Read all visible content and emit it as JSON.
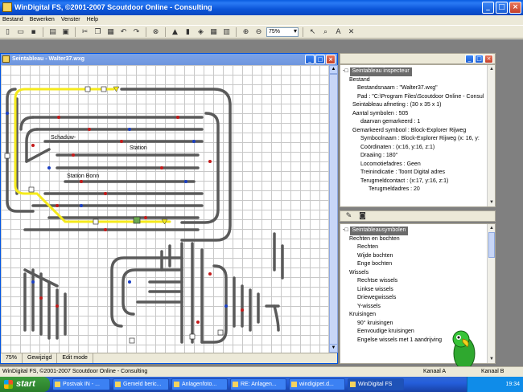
{
  "window": {
    "title": "WinDigital FS, ©2001-2007 Scoutdoor Online - Consulting",
    "buttons": {
      "minimize": "_",
      "maximize": "□",
      "close": "×"
    }
  },
  "menu": [
    "Bestand",
    "Bewerken",
    "Venster",
    "Help"
  ],
  "toolbar": {
    "zoom": "75%"
  },
  "child": {
    "title": "Seintableau - Walter37.wxg",
    "canvas_labels": {
      "schaduw": "Schaduw-",
      "station": "Station",
      "station_bonn": "Station Bonn"
    },
    "status": {
      "zoom": "75%",
      "state": "Gewijzigd",
      "mode": "Edit mode"
    }
  },
  "inspector": {
    "root": "Seintableau inspecteur",
    "items": [
      "Bestand",
      "Bestandsnaam : \"Walter37.wxg\"",
      "Pad : \"C:\\Program Files\\Scoutdoor Online - Consul",
      "Seintableau afmeting : (30 x 35 x 1)",
      "Aantal symbolen : 505",
      "daarvan gemarkeerd : 1",
      "Gemarkeerd symbool : Block-Explorer Rijweg",
      "Symboolnaam : Block-Explorer Rijweg (x: 16, y:",
      "Coördinaten : (x:16, y:16, z:1)",
      "Draaiing : 180°",
      "Locomotiefadres : Geen",
      "Treinindicatie : Toont Digital adres",
      "Terugmeldcontact : (x:17, y:16, z:1)",
      "Terugmeldadres : 20"
    ]
  },
  "symbols": {
    "root": "Seintableausymbolen",
    "items": [
      "Rechten en bochten",
      "Rechten",
      "Wijde bochten",
      "Enge bochten",
      "Wissels",
      "Rechtse wissels",
      "Linkse wissels",
      "Driewegwissels",
      "Y-wissels",
      "Kruisingen",
      "90° kruisingen",
      "Eenvoudige kruisingen",
      "Engelse wissels met 1 aandrijving"
    ]
  },
  "statusbar": {
    "text": "WinDigital FS, ©2001-2007 Scoutdoor Online - Consulting",
    "kanaal_a": "Kanaal A",
    "kanaal_b": "Kanaal B"
  },
  "taskbar": {
    "start": "start",
    "tasks": [
      "Postvak IN - ...",
      "Gemeld beric...",
      "Anlagenfoto...",
      "RE: Anlagen...",
      "windigipet.d...",
      "WinDigital FS"
    ],
    "clock": "19:34"
  }
}
